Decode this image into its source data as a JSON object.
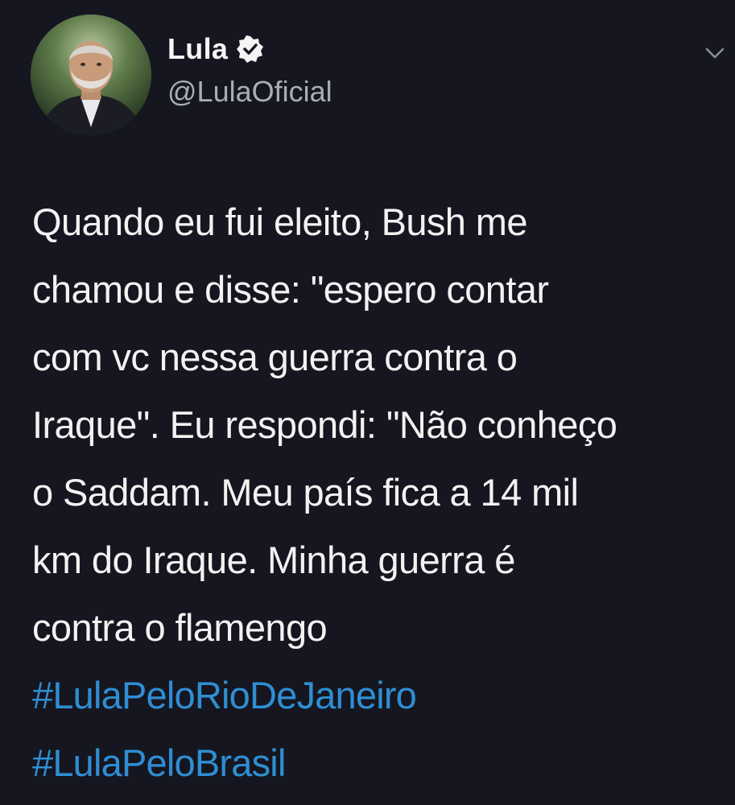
{
  "author": {
    "name": "Lula",
    "handle": "@LulaOficial",
    "verified": true,
    "verified_icon": "verified-badge-icon",
    "avatar": "profile-photo"
  },
  "menu": {
    "icon": "chevron-down-icon"
  },
  "tweet": {
    "text": "Quando eu fui eleito, Bush me\nchamou e disse: \"espero contar\ncom vc nessa guerra contra o\nIraque\". Eu respondi: \"Não conheço\no Saddam. Meu país fica a 14 mil\nkm do Iraque. Minha guerra é\ncontra o flamengo",
    "hashtags": [
      "#LulaPeloRioDeJaneiro",
      "#LulaPeloBrasil"
    ]
  },
  "colors": {
    "background": "#15161f",
    "text": "#f2f2f2",
    "handle": "#a9adb6",
    "hashtag": "#2f8ed3"
  }
}
